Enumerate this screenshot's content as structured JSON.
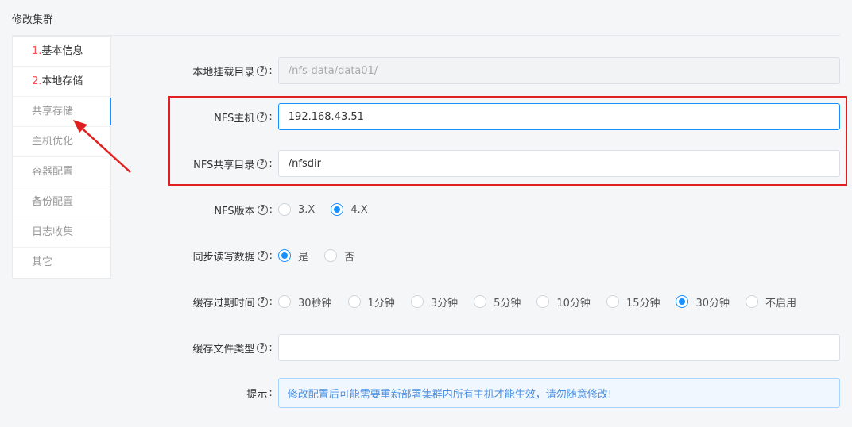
{
  "page": {
    "title": "修改集群"
  },
  "steps": [
    {
      "num": "1.",
      "label": "基本信息",
      "state": "done"
    },
    {
      "num": "2.",
      "label": "本地存储",
      "state": "done"
    },
    {
      "num": "",
      "label": "共享存储",
      "state": "active"
    },
    {
      "num": "",
      "label": "主机优化",
      "state": "pending"
    },
    {
      "num": "",
      "label": "容器配置",
      "state": "pending"
    },
    {
      "num": "",
      "label": "备份配置",
      "state": "pending"
    },
    {
      "num": "",
      "label": "日志收集",
      "state": "pending"
    },
    {
      "num": "",
      "label": "其它",
      "state": "pending"
    }
  ],
  "form": {
    "mount_dir": {
      "label": "本地挂载目录",
      "value": "/nfs-data/data01/"
    },
    "nfs_host": {
      "label": "NFS主机",
      "value": "192.168.43.51"
    },
    "nfs_share": {
      "label": "NFS共享目录",
      "value": "/nfsdir"
    },
    "nfs_version": {
      "label": "NFS版本",
      "options": [
        "3.X",
        "4.X"
      ],
      "selected": "4.X"
    },
    "sync_rw": {
      "label": "同步读写数据",
      "options": [
        "是",
        "否"
      ],
      "selected": "是"
    },
    "cache_expire": {
      "label": "缓存过期时间",
      "options": [
        "30秒钟",
        "1分钟",
        "3分钟",
        "5分钟",
        "10分钟",
        "15分钟",
        "30分钟",
        "不启用"
      ],
      "selected": "30分钟"
    },
    "cache_types": {
      "label": "缓存文件类型",
      "value": ""
    },
    "hint": {
      "label": "提示",
      "text": "修改配置后可能需要重新部署集群内所有主机才能生效，请勿随意修改!"
    }
  },
  "icons": {
    "help": "question-circle-icon"
  },
  "colors": {
    "accent": "#1890ff",
    "highlight": "#e02020",
    "step_number": "#ff4d4f"
  }
}
